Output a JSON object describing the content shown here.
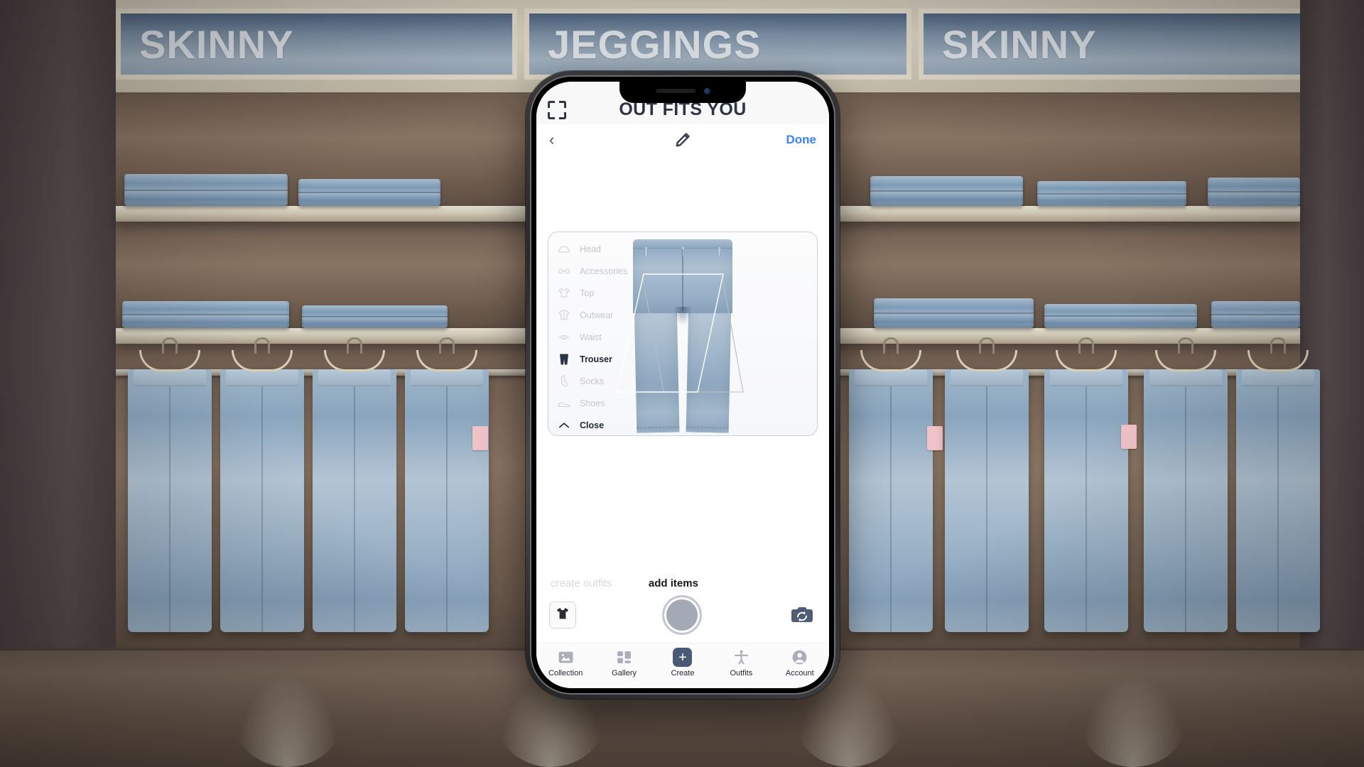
{
  "background": {
    "scene": "denim store shelving wall",
    "signs": [
      "SKINNY",
      "JEGGINGS",
      "SKINNY"
    ]
  },
  "phone": {
    "appbar": {
      "scan_icon": "scan-frame-icon",
      "title": "OUT FITS YOU"
    },
    "navrow": {
      "back": "‹",
      "edit_icon": "pencil-icon",
      "done_label": "Done",
      "done_color": "#3b82f6"
    },
    "picker": {
      "categories": [
        {
          "label": "Head",
          "icon": "hat-icon",
          "active": false
        },
        {
          "label": "Accessories",
          "icon": "glasses-icon",
          "active": false
        },
        {
          "label": "Top",
          "icon": "tshirt-icon",
          "active": false
        },
        {
          "label": "Outwear",
          "icon": "jacket-icon",
          "active": false
        },
        {
          "label": "Waist",
          "icon": "belt-icon",
          "active": false
        },
        {
          "label": "Trouser",
          "icon": "trousers-icon",
          "active": true
        },
        {
          "label": "Socks",
          "icon": "sock-icon",
          "active": false
        },
        {
          "label": "Shoes",
          "icon": "shoe-icon",
          "active": false
        }
      ],
      "close_label": "Close",
      "close_icon": "chevron-up-icon",
      "garment": "wide-leg blue jeans",
      "selection_shapes": 2
    },
    "actions": {
      "mode_inactive": "create outfits",
      "mode_active": "add items",
      "thumbnail_icon": "tshirt-thumbnail",
      "shutter_icon": "camera-shutter",
      "flip_icon": "camera-flip-icon"
    },
    "tabs": [
      {
        "label": "Collection",
        "icon": "image-icon",
        "active": false
      },
      {
        "label": "Gallery",
        "icon": "grid-icon",
        "active": false
      },
      {
        "label": "Create",
        "icon": "plus-icon",
        "active": true
      },
      {
        "label": "Outfits",
        "icon": "person-icon",
        "active": false
      },
      {
        "label": "Account",
        "icon": "account-icon",
        "active": false
      }
    ]
  },
  "colors": {
    "accent_blue": "#3b82f6",
    "slate": "#4a5a74",
    "title": "#2d3446",
    "muted": "#c2c7ce"
  }
}
